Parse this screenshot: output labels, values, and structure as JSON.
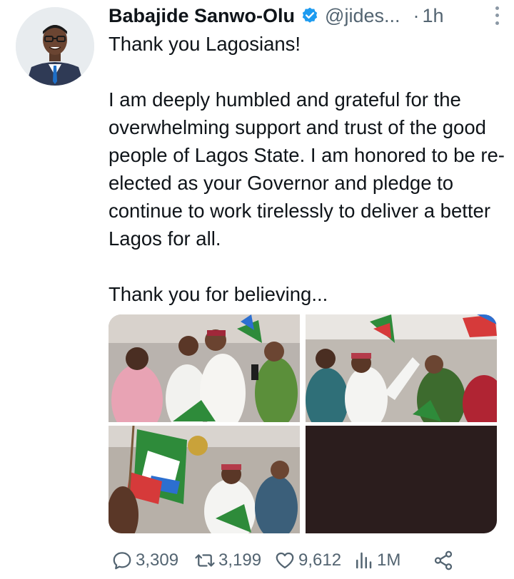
{
  "author": {
    "display_name": "Babajide Sanwo-Olu",
    "handle": "@jides...",
    "separator": "·",
    "time": "1h"
  },
  "tweet": {
    "line1": "Thank you Lagosians!",
    "line2": "I am deeply humbled and grateful for the overwhelming support and trust of the good people of Lagos State. I am honored to be re-elected as your Governor and pledge to continue to work tirelessly to deliver a better Lagos for all.",
    "line3": "Thank you for believing..."
  },
  "media": {
    "photo4_color": "#2b1d1d"
  },
  "stats": {
    "replies": "3,309",
    "retweets": "3,199",
    "likes": "9,612",
    "views": "1M"
  },
  "colors": {
    "verified": "#1d9bf0",
    "secondary_text": "#536471",
    "icon": "#536471"
  }
}
